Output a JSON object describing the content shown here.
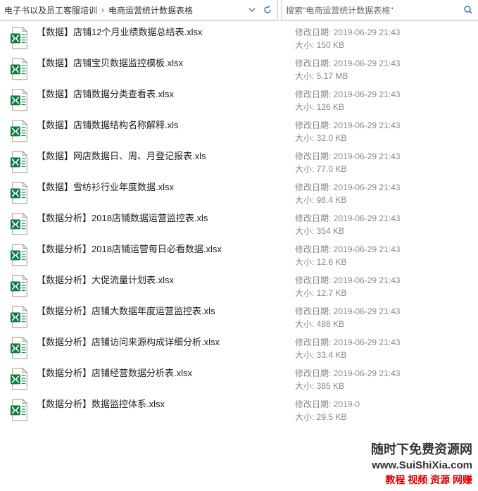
{
  "breadcrumb": {
    "part1": "电子书以及员工客服培训",
    "part2": "电商运营统计数据表格"
  },
  "search": {
    "placeholder": "搜索\"电商运营统计数据表格\""
  },
  "meta_labels": {
    "date_prefix": "修改日期: ",
    "size_prefix": "大小: "
  },
  "files": [
    {
      "name": "【数据】店铺12个月业绩数据总结表.xlsx",
      "date": "2019-06-29 21:43",
      "size": "150 KB"
    },
    {
      "name": "【数据】店铺宝贝数据监控模板.xlsx",
      "date": "2019-06-29 21:43",
      "size": "5.17 MB"
    },
    {
      "name": "【数据】店铺数据分类查看表.xlsx",
      "date": "2019-06-29 21:43",
      "size": "126 KB"
    },
    {
      "name": "【数据】店铺数据结构名称解释.xls",
      "date": "2019-06-29 21:43",
      "size": "32.0 KB"
    },
    {
      "name": "【数据】网店数据日、周、月登记报表.xls",
      "date": "2019-06-29 21:43",
      "size": "77.0 KB"
    },
    {
      "name": "【数据】雪纺衫行业年度数据.xlsx",
      "date": "2019-06-29 21:43",
      "size": "98.4 KB"
    },
    {
      "name": "【数据分析】2018店铺数据运营监控表.xls",
      "date": "2019-06-29 21:43",
      "size": "354 KB"
    },
    {
      "name": "【数据分析】2018店铺运营每日必看数据.xlsx",
      "date": "2019-06-29 21:43",
      "size": "12.6 KB"
    },
    {
      "name": "【数据分析】大促流量计划表.xlsx",
      "date": "2019-06-29 21:43",
      "size": "12.7 KB"
    },
    {
      "name": "【数据分析】店铺大数据年度运营监控表.xls",
      "date": "2019-06-29 21:43",
      "size": "488 KB"
    },
    {
      "name": "【数据分析】店铺访问来源构成详细分析.xlsx",
      "date": "2019-06-29 21:43",
      "size": "33.4 KB"
    },
    {
      "name": "【数据分析】店铺经营数据分析表.xlsx",
      "date": "2019-06-29 21:43",
      "size": "385 KB"
    },
    {
      "name": "【数据分析】数据监控体系.xlsx",
      "date": "2019-0",
      "size": "29.5 KB"
    }
  ],
  "watermark": {
    "line1": "随时下免费资源网",
    "line2": "www.SuiShiXia.com",
    "line3": "教程 视频 资源 网赚"
  }
}
